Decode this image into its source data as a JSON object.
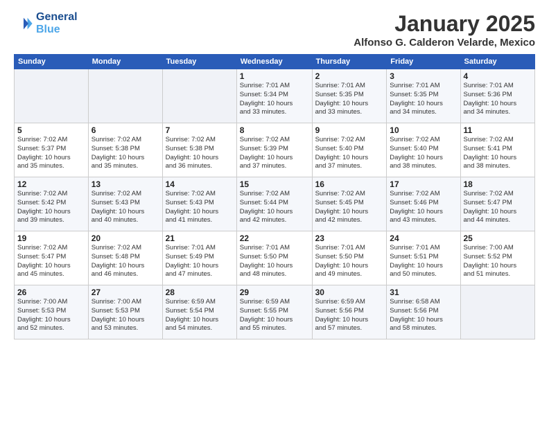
{
  "logo": {
    "line1": "General",
    "line2": "Blue"
  },
  "title": "January 2025",
  "subtitle": "Alfonso G. Calderon Velarde, Mexico",
  "weekdays": [
    "Sunday",
    "Monday",
    "Tuesday",
    "Wednesday",
    "Thursday",
    "Friday",
    "Saturday"
  ],
  "weeks": [
    [
      {
        "day": "",
        "info": ""
      },
      {
        "day": "",
        "info": ""
      },
      {
        "day": "",
        "info": ""
      },
      {
        "day": "1",
        "info": "Sunrise: 7:01 AM\nSunset: 5:34 PM\nDaylight: 10 hours\nand 33 minutes."
      },
      {
        "day": "2",
        "info": "Sunrise: 7:01 AM\nSunset: 5:35 PM\nDaylight: 10 hours\nand 33 minutes."
      },
      {
        "day": "3",
        "info": "Sunrise: 7:01 AM\nSunset: 5:35 PM\nDaylight: 10 hours\nand 34 minutes."
      },
      {
        "day": "4",
        "info": "Sunrise: 7:01 AM\nSunset: 5:36 PM\nDaylight: 10 hours\nand 34 minutes."
      }
    ],
    [
      {
        "day": "5",
        "info": "Sunrise: 7:02 AM\nSunset: 5:37 PM\nDaylight: 10 hours\nand 35 minutes."
      },
      {
        "day": "6",
        "info": "Sunrise: 7:02 AM\nSunset: 5:38 PM\nDaylight: 10 hours\nand 35 minutes."
      },
      {
        "day": "7",
        "info": "Sunrise: 7:02 AM\nSunset: 5:38 PM\nDaylight: 10 hours\nand 36 minutes."
      },
      {
        "day": "8",
        "info": "Sunrise: 7:02 AM\nSunset: 5:39 PM\nDaylight: 10 hours\nand 37 minutes."
      },
      {
        "day": "9",
        "info": "Sunrise: 7:02 AM\nSunset: 5:40 PM\nDaylight: 10 hours\nand 37 minutes."
      },
      {
        "day": "10",
        "info": "Sunrise: 7:02 AM\nSunset: 5:40 PM\nDaylight: 10 hours\nand 38 minutes."
      },
      {
        "day": "11",
        "info": "Sunrise: 7:02 AM\nSunset: 5:41 PM\nDaylight: 10 hours\nand 38 minutes."
      }
    ],
    [
      {
        "day": "12",
        "info": "Sunrise: 7:02 AM\nSunset: 5:42 PM\nDaylight: 10 hours\nand 39 minutes."
      },
      {
        "day": "13",
        "info": "Sunrise: 7:02 AM\nSunset: 5:43 PM\nDaylight: 10 hours\nand 40 minutes."
      },
      {
        "day": "14",
        "info": "Sunrise: 7:02 AM\nSunset: 5:43 PM\nDaylight: 10 hours\nand 41 minutes."
      },
      {
        "day": "15",
        "info": "Sunrise: 7:02 AM\nSunset: 5:44 PM\nDaylight: 10 hours\nand 42 minutes."
      },
      {
        "day": "16",
        "info": "Sunrise: 7:02 AM\nSunset: 5:45 PM\nDaylight: 10 hours\nand 42 minutes."
      },
      {
        "day": "17",
        "info": "Sunrise: 7:02 AM\nSunset: 5:46 PM\nDaylight: 10 hours\nand 43 minutes."
      },
      {
        "day": "18",
        "info": "Sunrise: 7:02 AM\nSunset: 5:47 PM\nDaylight: 10 hours\nand 44 minutes."
      }
    ],
    [
      {
        "day": "19",
        "info": "Sunrise: 7:02 AM\nSunset: 5:47 PM\nDaylight: 10 hours\nand 45 minutes."
      },
      {
        "day": "20",
        "info": "Sunrise: 7:02 AM\nSunset: 5:48 PM\nDaylight: 10 hours\nand 46 minutes."
      },
      {
        "day": "21",
        "info": "Sunrise: 7:01 AM\nSunset: 5:49 PM\nDaylight: 10 hours\nand 47 minutes."
      },
      {
        "day": "22",
        "info": "Sunrise: 7:01 AM\nSunset: 5:50 PM\nDaylight: 10 hours\nand 48 minutes."
      },
      {
        "day": "23",
        "info": "Sunrise: 7:01 AM\nSunset: 5:50 PM\nDaylight: 10 hours\nand 49 minutes."
      },
      {
        "day": "24",
        "info": "Sunrise: 7:01 AM\nSunset: 5:51 PM\nDaylight: 10 hours\nand 50 minutes."
      },
      {
        "day": "25",
        "info": "Sunrise: 7:00 AM\nSunset: 5:52 PM\nDaylight: 10 hours\nand 51 minutes."
      }
    ],
    [
      {
        "day": "26",
        "info": "Sunrise: 7:00 AM\nSunset: 5:53 PM\nDaylight: 10 hours\nand 52 minutes."
      },
      {
        "day": "27",
        "info": "Sunrise: 7:00 AM\nSunset: 5:53 PM\nDaylight: 10 hours\nand 53 minutes."
      },
      {
        "day": "28",
        "info": "Sunrise: 6:59 AM\nSunset: 5:54 PM\nDaylight: 10 hours\nand 54 minutes."
      },
      {
        "day": "29",
        "info": "Sunrise: 6:59 AM\nSunset: 5:55 PM\nDaylight: 10 hours\nand 55 minutes."
      },
      {
        "day": "30",
        "info": "Sunrise: 6:59 AM\nSunset: 5:56 PM\nDaylight: 10 hours\nand 57 minutes."
      },
      {
        "day": "31",
        "info": "Sunrise: 6:58 AM\nSunset: 5:56 PM\nDaylight: 10 hours\nand 58 minutes."
      },
      {
        "day": "",
        "info": ""
      }
    ]
  ]
}
